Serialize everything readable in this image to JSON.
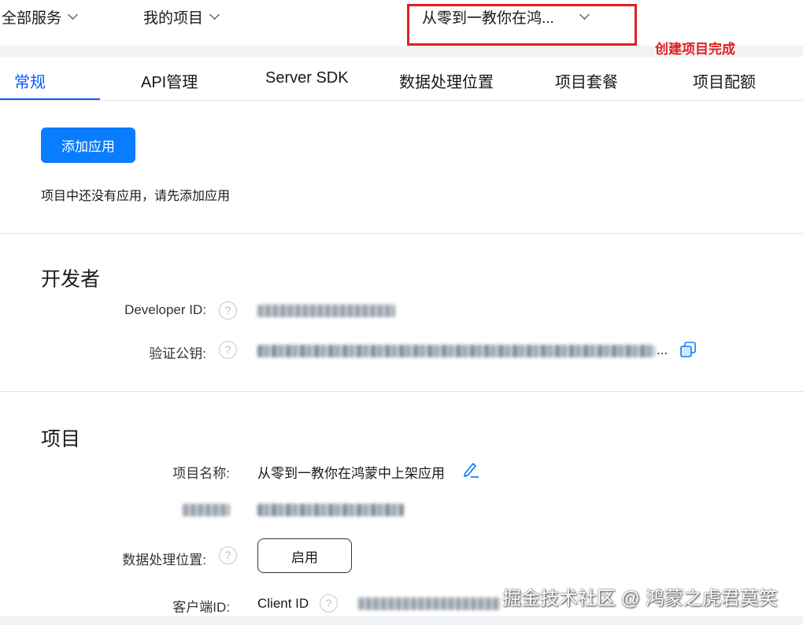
{
  "topbar": {
    "all_services": "全部服务",
    "my_projects": "我的项目",
    "current_project": "从零到一教你在鸿..."
  },
  "annotation": "创建项目完成",
  "tabs": [
    "常规",
    "API管理",
    "Server SDK",
    "数据处理位置",
    "项目套餐",
    "项目配额"
  ],
  "apps": {
    "add_button": "添加应用",
    "empty_hint": "项目中还没有应用，请先添加应用"
  },
  "developer": {
    "title": "开发者",
    "developer_id_label": "Developer ID:",
    "public_key_label": "验证公钥:",
    "public_key_suffix": "..."
  },
  "project": {
    "title": "项目",
    "name_label": "项目名称:",
    "name_value": "从零到一教你在鸿蒙中上架应用",
    "data_location_label": "数据处理位置:",
    "enable_button": "启用",
    "client_id_label": "客户端ID:",
    "client_id_prefix": "Client ID"
  },
  "watermark": "掘金技术社区 @ 鸿蒙之虎君莫笑",
  "colors": {
    "accent": "#0a59f7",
    "button_blue": "#0a7cff",
    "annotation_red": "#e02020"
  }
}
